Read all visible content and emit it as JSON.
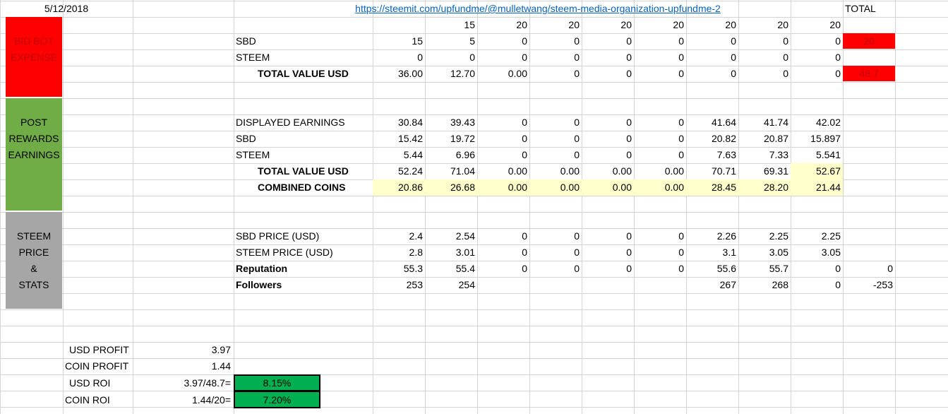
{
  "colors": {
    "grid": "#d4d4d4",
    "red": "#ff0000",
    "green_section": "#70ad47",
    "gray_section": "#a6a6a6",
    "yellow_highlight": "#ffffcc",
    "roi_green": "#00b050",
    "link": "#0563c1"
  },
  "header": {
    "date": "5/12/2018",
    "url": "https://steemit.com/upfundme/@mulletwang/steem-media-organization-upfundme-2",
    "total_label": "TOTAL",
    "bid_amounts": [
      "15",
      "20",
      "20",
      "20",
      "20",
      "20",
      "20",
      "20"
    ]
  },
  "sections": {
    "bid_bot": {
      "label_line1": "BID BOT",
      "label_line2": "EXPENSE"
    },
    "post_rewards": {
      "label_line1": "POST",
      "label_line2": "REWARDS",
      "label_line3": "EARNINGS"
    },
    "steem_stats": {
      "label_line1": "STEEM",
      "label_line2": "PRICE",
      "label_line3": "&",
      "label_line4": "STATS"
    }
  },
  "rows": {
    "bid_sbd": {
      "label": "SBD",
      "values": [
        "15",
        "5",
        "0",
        "0",
        "0",
        "0",
        "0",
        "0",
        "0"
      ],
      "total": "20"
    },
    "bid_steem": {
      "label": "STEEM",
      "values": [
        "0",
        "0",
        "0",
        "0",
        "0",
        "0",
        "0",
        "0",
        "0"
      ],
      "total": ""
    },
    "bid_total_usd": {
      "label": "TOTAL VALUE USD",
      "values": [
        "36.00",
        "12.70",
        "0.00",
        "0",
        "0",
        "0",
        "0",
        "0",
        "0"
      ],
      "total": "48.7"
    },
    "displayed": {
      "label": "DISPLAYED EARNINGS",
      "values": [
        "30.84",
        "39.43",
        "0",
        "0",
        "0",
        "0",
        "41.64",
        "41.74",
        "42.02"
      ],
      "total": ""
    },
    "earn_sbd": {
      "label": "SBD",
      "values": [
        "15.42",
        "19.72",
        "0",
        "0",
        "0",
        "0",
        "20.82",
        "20.87",
        "15.897"
      ],
      "total": ""
    },
    "earn_steem": {
      "label": "STEEM",
      "values": [
        "5.44",
        "6.96",
        "0",
        "0",
        "0",
        "0",
        "7.63",
        "7.33",
        "5.541"
      ],
      "total": ""
    },
    "earn_total_usd": {
      "label": "TOTAL VALUE USD",
      "values": [
        "52.24",
        "71.04",
        "0.00",
        "0.00",
        "0.00",
        "0.00",
        "70.71",
        "69.31",
        "52.67"
      ],
      "total": ""
    },
    "combined": {
      "label": "COMBINED COINS",
      "values": [
        "20.86",
        "26.68",
        "0.00",
        "0.00",
        "0.00",
        "0.00",
        "28.45",
        "28.20",
        "21.44"
      ],
      "total": ""
    },
    "sbd_price": {
      "label": "SBD PRICE (USD)",
      "values": [
        "2.4",
        "2.54",
        "0",
        "0",
        "0",
        "0",
        "2.26",
        "2.25",
        "2.25"
      ],
      "total": ""
    },
    "steem_price": {
      "label": "STEEM PRICE (USD)",
      "values": [
        "2.8",
        "3.01",
        "0",
        "0",
        "0",
        "0",
        "3.1",
        "3.05",
        "3.05"
      ],
      "total": ""
    },
    "reputation": {
      "label": "Reputation",
      "values": [
        "55.3",
        "55.4",
        "0",
        "0",
        "0",
        "0",
        "55.6",
        "55.7",
        "0"
      ],
      "total": "0"
    },
    "followers": {
      "label": "Followers",
      "values": [
        "253",
        "254",
        "",
        "",
        "",
        "",
        "267",
        "268",
        "0"
      ],
      "total": "-253"
    }
  },
  "summary": {
    "usd_profit": {
      "label": "USD PROFIT",
      "value": "3.97"
    },
    "coin_profit": {
      "label": "COIN PROFIT",
      "value": "1.44"
    },
    "usd_roi": {
      "label": "USD ROI",
      "formula": "3.97/48.7=",
      "result": "8.15%"
    },
    "coin_roi": {
      "label": "COIN ROI",
      "formula": "1.44/20=",
      "result": "7.20%"
    }
  }
}
